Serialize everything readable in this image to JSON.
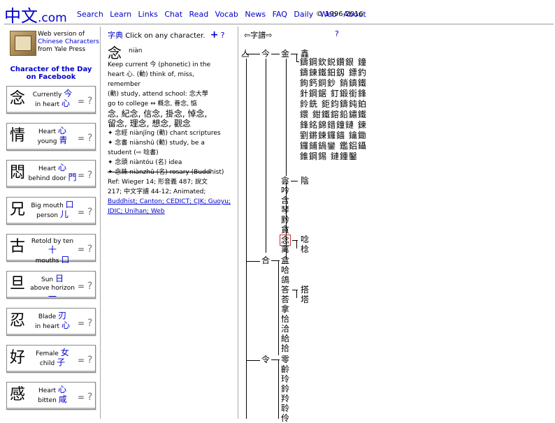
{
  "header": {
    "logo": "中文",
    "logo_suffix": ".com",
    "nav": [
      "Search",
      "Learn",
      "Links",
      "Chat",
      "Read",
      "Vocab",
      "News",
      "FAQ",
      "Daily",
      "Web",
      "About"
    ],
    "copyright": "© 1996-2016"
  },
  "left": {
    "webversion_l1": "Web version of",
    "webversion_l2": "Chinese Characters",
    "webversion_l3": "from Yale Press",
    "cotd_l1": "Character of the Day",
    "cotd_l2": "on Facebook",
    "cards": [
      {
        "ch": "念",
        "l1": "Currently",
        "c1": "今",
        "l2": "in heart",
        "c2": "心"
      },
      {
        "ch": "情",
        "l1": "Heart",
        "c1": "心",
        "l2": "young",
        "c2": "青"
      },
      {
        "ch": "悶",
        "l1": "Heart",
        "c1": "心",
        "l2": "behind door",
        "c2": "門"
      },
      {
        "ch": "兄",
        "l1": "Big mouth",
        "c1": "口",
        "l2": "person",
        "c2": "儿"
      },
      {
        "ch": "古",
        "l1": "Retold by ten",
        "c1": "十",
        "l2": "mouths",
        "c2": "口"
      },
      {
        "ch": "旦",
        "l1": "Sun",
        "c1": "日",
        "l2": "above horizon",
        "c2": "一"
      },
      {
        "ch": "忍",
        "l1": "Blade",
        "c1": "刃",
        "l2": "in heart",
        "c2": "心"
      },
      {
        "ch": "好",
        "l1": "Female",
        "c1": "女",
        "l2": "child",
        "c2": "子"
      },
      {
        "ch": "感",
        "l1": "Heart",
        "c1": "心",
        "l2": "bitten",
        "c2": "咸"
      }
    ],
    "card_eq": "=",
    "card_q": "?"
  },
  "dict": {
    "title": "字典",
    "instruction": "Click on any character.",
    "plus": "+",
    "help": "?",
    "char": "念",
    "pinyin": "niàn",
    "def_l1": "Keep current 今 (phonetic) in the",
    "def_l2": "heart 心. (動) think of, miss, remember",
    "def_l3": "(動) study, attend school: 念大學",
    "def_l4": "go to college ⇔ 概念, 眷念, 惦",
    "def_l5": "念, 紀念, 信念, 掛念, 悼念,",
    "def_l6": "留念, 理念, 想念, 觀念",
    "def_l7": "✦ 念經 niànjīng (動) chant scriptures",
    "def_l8": "✦ 念書 niànshū (動) study, be a",
    "def_l9": "student (⇨ 唸書)",
    "def_l10": "✦ 念頭 niàntóu (名) idea",
    "def_l11": "✦ 念珠 niànzhū (名) rosary (Buddhist)",
    "ref_l1": "Ref: Wieger 14; 形音義 487; 說文",
    "ref_l2": "217; 中文字譜 44-12; Animated;",
    "ref_l3": "Buddhist; Canton; CEDICT; CJK; Guoyu;",
    "ref_l4": "JDIC; Unihan; Web"
  },
  "tree": {
    "title": "⇦字譜⇨",
    "help": "?",
    "root": "亼",
    "jin": "今",
    "jin2": "金",
    "xin": "鑫",
    "jin_block": "鑄鋼欽鋭鑽銀 鐘鑄鍊鐵鈤釼 鏢釣鉤鈣銅鈔 銷鎮鐵針鋼鋸 釘鍛銜鋒鈴銑 鉅鈞鑄鈍鉑鐶 鉗鐵鎔鉛鏽鐵 鋒銘錦錯鐘鏈 鍊劉鏘鍊鑼錨 鑰鋤鑼鋪鍋鑾 鑑鋁鑷錐鋼錫 鏈鍾鑿",
    "yin": "侌",
    "yin2": "陰",
    "col1": [
      "吟",
      "含",
      "琴",
      "黔",
      "貪",
      "念",
      "禽"
    ],
    "nian2a": "唸",
    "nian2b": "棯",
    "he": "合",
    "col2": [
      "盒",
      "哈",
      "鴿",
      "答",
      "荅",
      "拿",
      "恰",
      "洽",
      "給",
      "拾"
    ],
    "da1": "搭",
    "da2": "塔",
    "ling": "令",
    "col3": [
      "零",
      "齡",
      "玲",
      "鈴",
      "羚",
      "聆",
      "伶"
    ]
  }
}
